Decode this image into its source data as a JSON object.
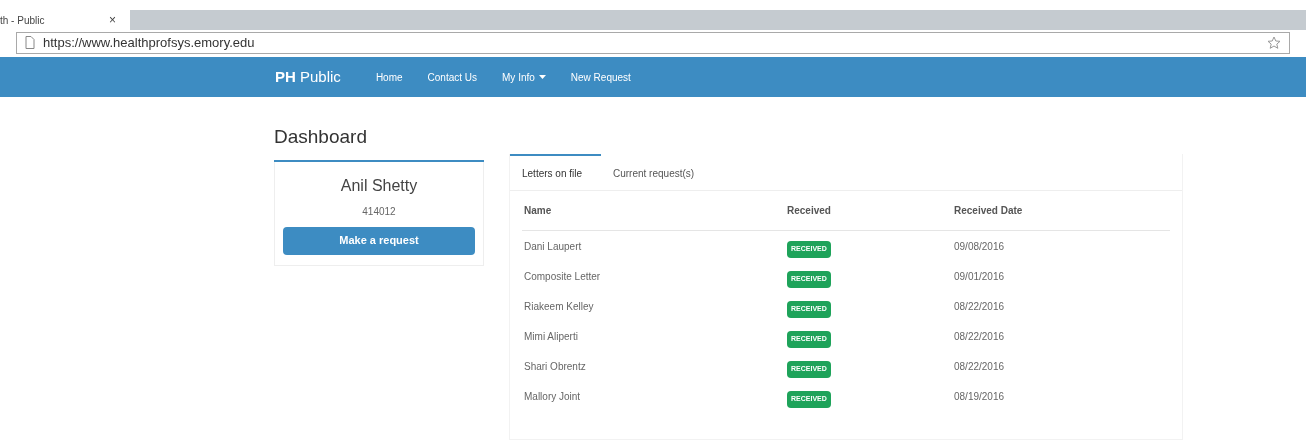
{
  "browser": {
    "tab": {
      "title": "th - Public",
      "close": "×"
    },
    "url": "https://www.healthprofsys.emory.edu"
  },
  "navbar": {
    "brand_bold": "PH",
    "brand": "Public",
    "links": [
      {
        "label": "Home",
        "dropdown": false
      },
      {
        "label": "Contact Us",
        "dropdown": false
      },
      {
        "label": "My Info",
        "dropdown": true
      },
      {
        "label": "New Request",
        "dropdown": false
      }
    ]
  },
  "title": "Dashboard",
  "profile": {
    "name": "Anil Shetty",
    "id": "414012",
    "button": "Make a request"
  },
  "tabs": [
    {
      "label": "Letters on file",
      "selected": true
    },
    {
      "label": "Current request(s)",
      "selected": false
    }
  ],
  "table": {
    "columns": [
      "Name",
      "Received",
      "Received Date"
    ],
    "rows": [
      {
        "name": "Dani Laupert",
        "status": "RECEIVED",
        "date": "09/08/2016"
      },
      {
        "name": "Composite Letter",
        "status": "RECEIVED",
        "date": "09/01/2016"
      },
      {
        "name": "Riakeem Kelley",
        "status": "RECEIVED",
        "date": "08/22/2016"
      },
      {
        "name": "Mimi Aliperti",
        "status": "RECEIVED",
        "date": "08/22/2016"
      },
      {
        "name": "Shari Obrentz",
        "status": "RECEIVED",
        "date": "08/22/2016"
      },
      {
        "name": "Mallory Joint",
        "status": "RECEIVED",
        "date": "08/19/2016"
      }
    ]
  }
}
